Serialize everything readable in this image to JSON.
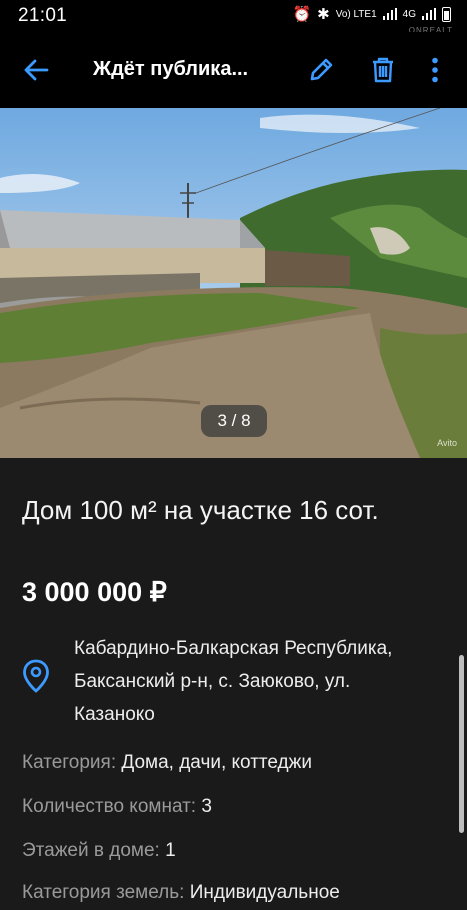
{
  "status": {
    "time": "21:01",
    "network": "Vo) LTE1",
    "net_type": "4G"
  },
  "watermark": "ONREALT",
  "toolbar": {
    "title": "Ждёт публика...",
    "back_icon": "arrow-left-icon",
    "edit_icon": "pencil-icon",
    "delete_icon": "trash-icon",
    "menu_icon": "more-vertical-icon",
    "accent": "#3d9bff"
  },
  "gallery": {
    "counter": "3 / 8",
    "current": 3,
    "total": 8,
    "source_mark": "Avito"
  },
  "listing": {
    "title": "Дом 100 м² на участке 16 сот.",
    "price": "3 000 000 ₽",
    "address": "Кабардино-Балкарская Республика, Баксанский р-н, с. Заюково, ул. Казаноко",
    "pin_icon": "location-pin-icon",
    "params": [
      {
        "key": "Категория:",
        "value": "Дома, дачи, коттеджи"
      },
      {
        "key": "Количество комнат:",
        "value": "3"
      },
      {
        "key": "Этажей в доме:",
        "value": "1"
      },
      {
        "key": "Категория земель:",
        "value": "Индивидуальное"
      }
    ]
  }
}
